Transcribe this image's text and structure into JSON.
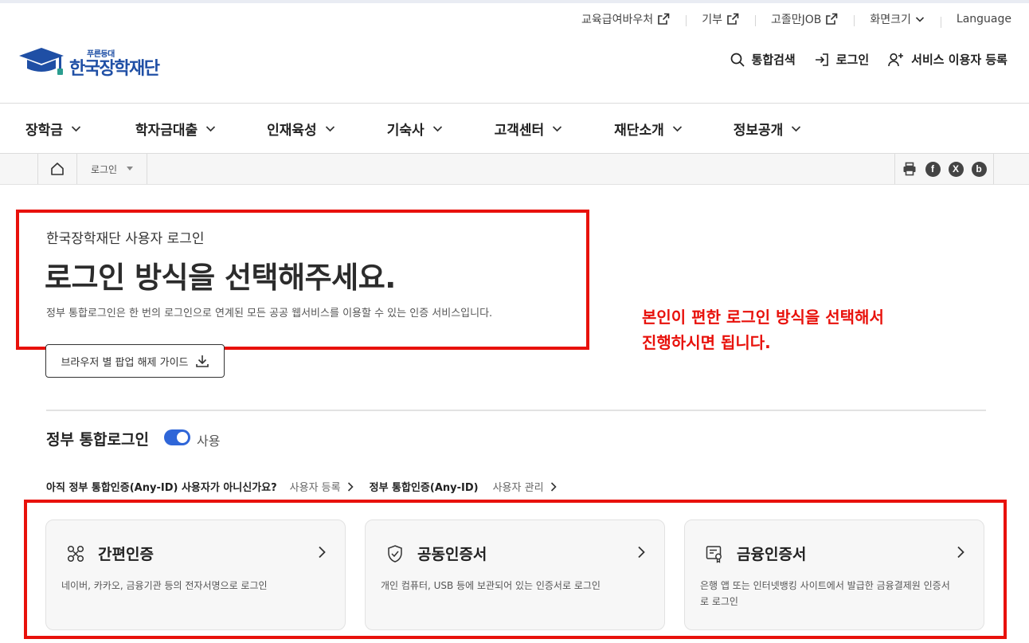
{
  "utility": {
    "items": [
      {
        "label": "교육급여바우처",
        "icon": "external-link-icon"
      },
      {
        "label": "기부",
        "icon": "external-link-icon"
      },
      {
        "label": "고졸만JOB",
        "icon": "external-link-icon"
      },
      {
        "label": "화면크기",
        "icon": "chevron-down-icon"
      },
      {
        "label": "Language",
        "icon": ""
      }
    ]
  },
  "logo": {
    "sub": "푸른등대",
    "main": "한국장학재단"
  },
  "member": {
    "search": "통합검색",
    "login": "로그인",
    "register": "서비스 이용자 등록"
  },
  "gnb": [
    "장학금",
    "학자금대출",
    "인재육성",
    "기숙사",
    "고객센터",
    "재단소개",
    "정보공개"
  ],
  "breadcrumb": {
    "current": "로그인"
  },
  "share_icons": [
    "print-icon",
    "facebook-icon",
    "x-icon",
    "blog-icon"
  ],
  "intro": {
    "subtitle": "한국장학재단 사용자 로그인",
    "title": "로그인 방식을 선택해주세요.",
    "desc": "정부 통합로그인은 한 번의 로그인으로 연계된 모든 공공 웹서비스를 이용할 수 있는 인증 서비스입니다.",
    "guide_button": "브라우저 별 팝업 해제 가이드"
  },
  "annotation": {
    "line1": "본인이 편한 로그인 방식을 선택해서",
    "line2": "진행하시면 됩니다."
  },
  "gov_login": {
    "title": "정부 통합로그인",
    "toggle_on": true,
    "toggle_label": "사용",
    "question": "아직 정부 통합인증(Any-ID) 사용자가 아니신가요?",
    "register_link": "사용자 등록",
    "anyid_label": "정부 통합인증(Any-ID)",
    "manage_link": "사용자 관리"
  },
  "cards": [
    {
      "title": "간편인증",
      "desc": "네이버, 카카오, 금융기관 등의 전자서명으로 로그인",
      "icon": "simple-auth-icon"
    },
    {
      "title": "공동인증서",
      "desc": "개인 컴퓨터, USB 등에 보관되어 있는 인증서로 로그인",
      "icon": "shield-check-icon"
    },
    {
      "title": "금융인증서",
      "desc": "은행 앱 또는 인터넷뱅킹 사이트에서 발급한 금융결제원 인증서로 로그인",
      "icon": "certificate-icon"
    }
  ],
  "colors": {
    "brand": "#1f4fa5",
    "toggle": "#2f66d8",
    "highlight": "#e8110b"
  }
}
